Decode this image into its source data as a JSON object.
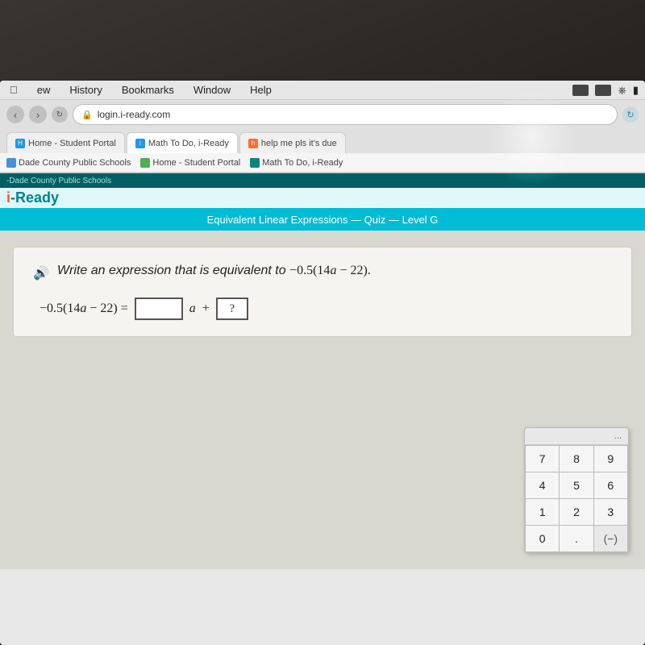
{
  "browser": {
    "menu_items": [
      "ew",
      "History",
      "Bookmarks",
      "Window",
      "Help"
    ],
    "address": "login.i-ready.com",
    "tabs": [
      {
        "label": "Home - Student Portal",
        "icon_color": "blue",
        "active": false
      },
      {
        "label": "Math To Do, i-Ready",
        "icon_color": "teal",
        "active": true
      },
      {
        "label": "help me pls it's due",
        "icon_color": "orange",
        "active": false
      }
    ],
    "bookmarks": [
      {
        "label": "Dade County Public Schools"
      },
      {
        "label": "Home - Student Portal"
      },
      {
        "label": "Math To Do, i-Ready"
      }
    ]
  },
  "page_title": "Equivalent Linear Expressions — Quiz — Level G",
  "iready_logo": "i-Ready",
  "dade_bar_text": "-Dade County Public Schools",
  "question": {
    "prompt": "Write an expression that is equivalent to −0.5(14a − 22).",
    "equation_lhs": "−0.5(14a − 22) =",
    "input_placeholder_1": "",
    "variable": "a",
    "operator": "+",
    "input_placeholder_2": "?"
  },
  "calculator": {
    "header": "...",
    "buttons": [
      {
        "label": "7"
      },
      {
        "label": "8"
      },
      {
        "label": "9"
      },
      {
        "label": "4"
      },
      {
        "label": "5"
      },
      {
        "label": "6"
      },
      {
        "label": "1"
      },
      {
        "label": "2"
      },
      {
        "label": "3"
      },
      {
        "label": "0"
      },
      {
        "label": "."
      },
      {
        "label": "(−)",
        "special": true
      }
    ]
  }
}
